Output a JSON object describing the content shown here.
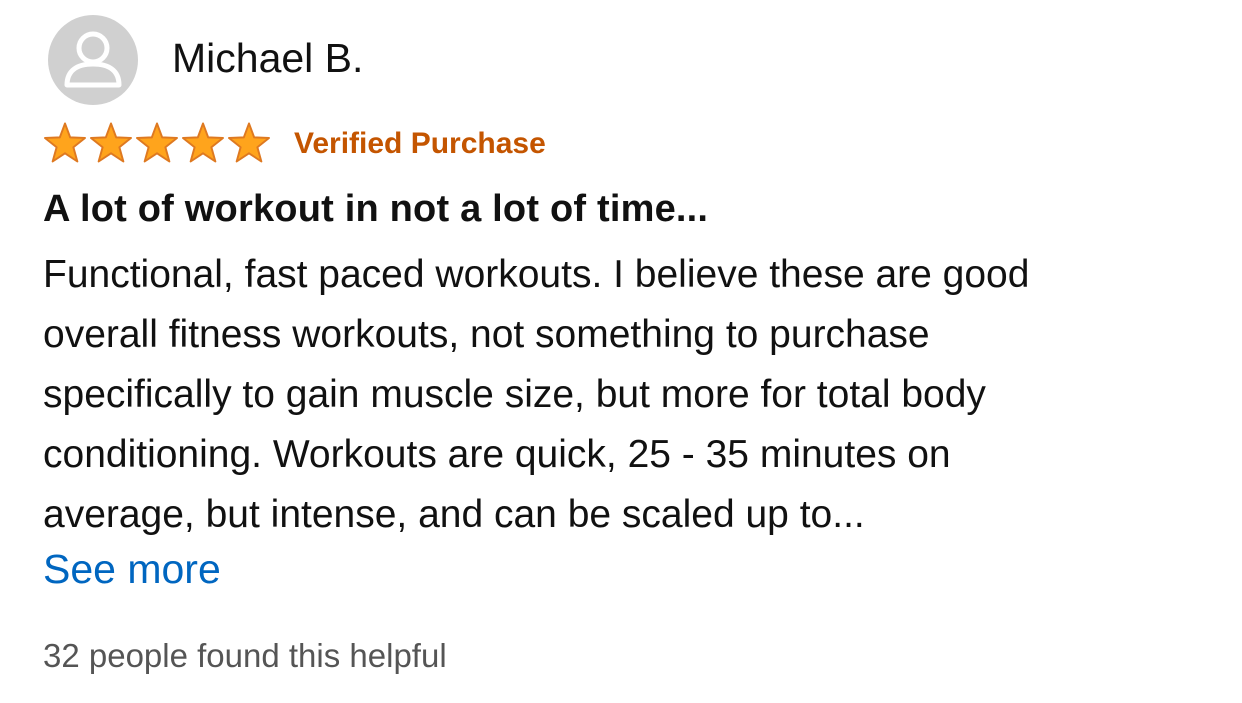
{
  "review": {
    "author": "Michael B.",
    "rating": 5,
    "rating_max": 5,
    "verified_label": "Verified Purchase",
    "title": "A lot of workout in not a lot of time...",
    "body_lines": [
      "Functional, fast paced workouts. I believe these are good",
      "overall fitness workouts, not something to purchase",
      "specifically to gain muscle size, but more for total body",
      "conditioning. Workouts are quick, 25 - 35 minutes on",
      "average, but intense, and can be scaled up to..."
    ],
    "see_more_label": "See more",
    "helpful_text": "32 people found this helpful"
  },
  "icons": {
    "avatar": "user-avatar-icon",
    "star": "star-icon"
  },
  "colors": {
    "star_fill": "#ffa41c",
    "star_stroke": "#de7921",
    "verified": "#c45500",
    "link": "#0066c0",
    "muted": "#555555",
    "avatar_bg": "#d0d0d0"
  }
}
